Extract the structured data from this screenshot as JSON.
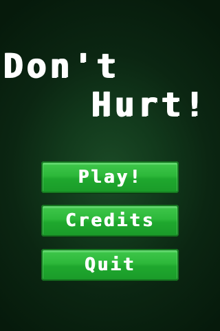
{
  "title": {
    "line1": "Don't",
    "line2": "Hurt!"
  },
  "menu": {
    "play_label": "Play!",
    "credits_label": "Credits",
    "quit_label": "Quit"
  },
  "colors": {
    "background": "#0b2612",
    "button": "#2db83a",
    "text": "#ffffff"
  }
}
